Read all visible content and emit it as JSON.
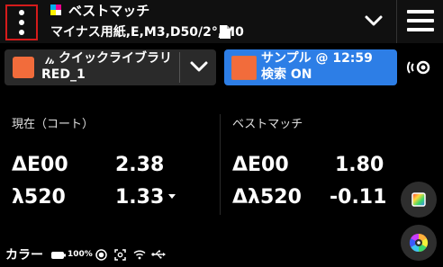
{
  "header": {
    "title": "ベストマッチ",
    "conditions": "マイナス用紙,E,M3,D50/2°,M0"
  },
  "library": {
    "name": "クイックライブラリ",
    "color": "RED_1",
    "swatch_color": "#f26c3b"
  },
  "sample": {
    "title": "サンプル @ 12:59",
    "search": "検索 ON",
    "swatch_color": "#f26c3b",
    "panel_color": "#2d7ee6"
  },
  "current": {
    "label": "現在（コート）",
    "de_label": "ΔE00",
    "de_value": "2.38",
    "lambda_label": "λ520",
    "lambda_value": "1.33"
  },
  "best": {
    "label": "ベストマッチ",
    "de_label": "ΔE00",
    "de_value": "1.80",
    "lambda_label": "Δλ520",
    "lambda_value": "-0.11"
  },
  "status": {
    "label": "カラー",
    "battery": "100%"
  },
  "icons": [
    "menu-dots-icon",
    "cmyk-icon",
    "document-icon",
    "chevron-down-icon",
    "hamburger-icon",
    "library-icon",
    "measure-icon",
    "color-palette-icon",
    "color-wheel-icon",
    "battery-icon",
    "target-icon",
    "focus-icon",
    "wifi-icon",
    "usb-icon"
  ]
}
